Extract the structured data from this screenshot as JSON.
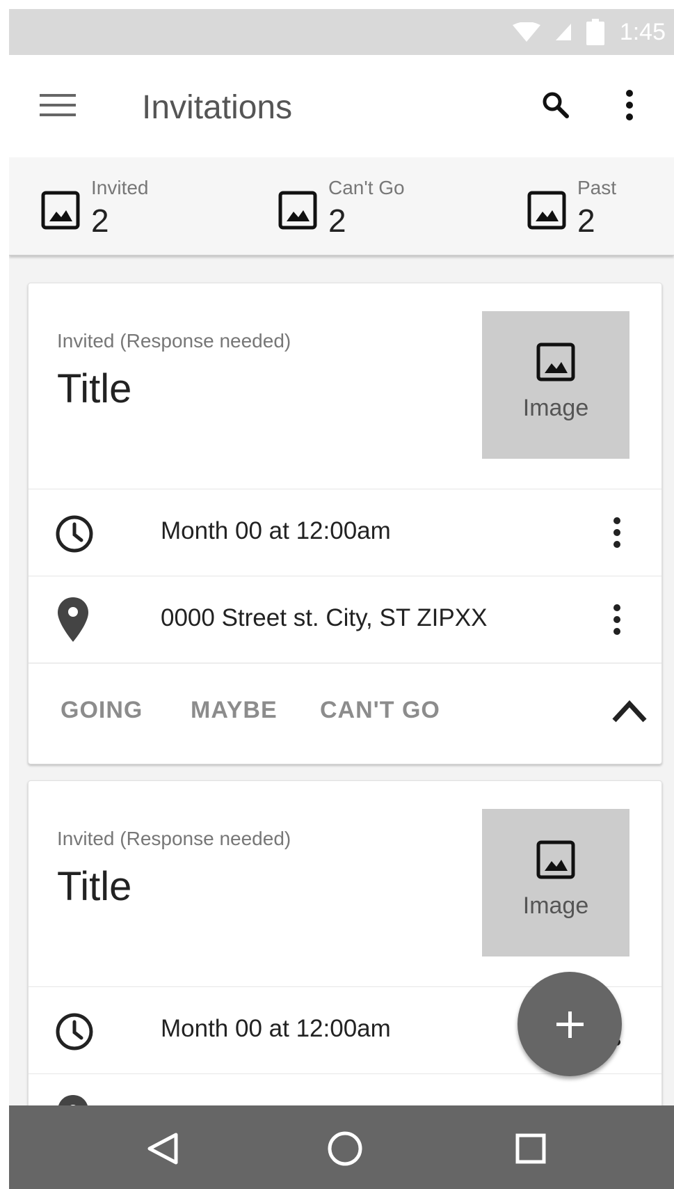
{
  "status_bar": {
    "time": "1:45",
    "icons": [
      "wifi-icon",
      "signal-icon",
      "battery-icon"
    ]
  },
  "app_bar": {
    "title": "Invitations",
    "icons": [
      "menu-icon",
      "search-icon",
      "more-vert-icon"
    ]
  },
  "stats": [
    {
      "label": "Invited",
      "count": "2",
      "icon": "image-icon"
    },
    {
      "label": "Can't Go",
      "count": "2",
      "icon": "image-icon"
    },
    {
      "label": "Past",
      "count": "2",
      "icon": "image-icon"
    }
  ],
  "cards": [
    {
      "subtitle": "Invited (Response needed)",
      "title": "Title",
      "image_label": "Image",
      "datetime": "Month 00 at 12:00am",
      "address": "0000 Street st. City, ST ZIPXX",
      "actions": [
        "GOING",
        "MAYBE",
        "CAN'T GO"
      ]
    },
    {
      "subtitle": "Invited (Response needed)",
      "title": "Title",
      "image_label": "Image",
      "datetime": "Month 00 at 12:00am"
    }
  ],
  "fab": {
    "icon": "plus-icon"
  },
  "nav_bar": {
    "icons": [
      "back-icon",
      "home-icon",
      "recents-icon"
    ]
  },
  "colors": {
    "status_bar": "#d9d9d9",
    "nav_bar": "#666666",
    "fab": "#666666",
    "image_placeholder": "#cccccc"
  }
}
